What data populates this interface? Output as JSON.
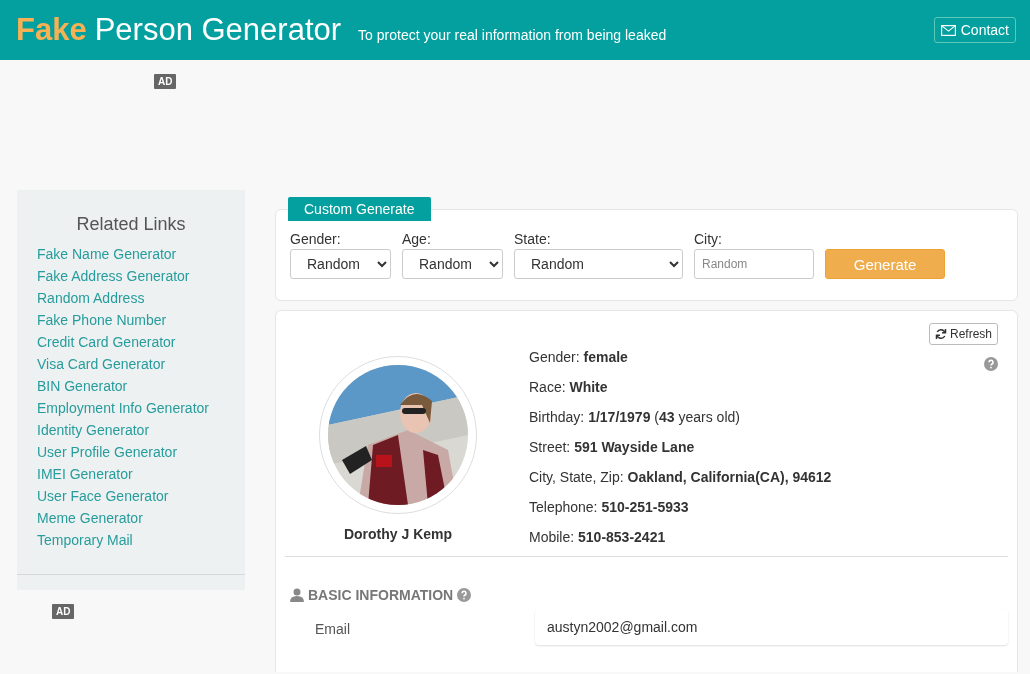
{
  "header": {
    "brand_accent": "Fake",
    "brand_rest": "Person Generator",
    "tagline": "To protect your real information from being leaked",
    "contact": "Contact"
  },
  "ads": [
    "AD",
    "AD"
  ],
  "sidebar": {
    "title": "Related Links",
    "links": [
      "Fake Name Generator",
      "Fake Address Generator",
      "Random Address",
      "Fake Phone Number",
      "Credit Card Generator",
      "Visa Card Generator",
      "BIN Generator",
      "Employment Info Generator",
      "Identity Generator",
      "User Profile Generator",
      "IMEI Generator",
      "User Face Generator",
      "Meme Generator",
      "Temporary Mail"
    ]
  },
  "custom_generate": {
    "tab": "Custom Generate",
    "fields": [
      {
        "kind": "select",
        "label": "Gender:",
        "value": "Random"
      },
      {
        "kind": "select",
        "label": "Age:",
        "value": "Random"
      },
      {
        "kind": "select",
        "label": "State:",
        "value": "Random"
      },
      {
        "kind": "input",
        "label": "City:",
        "placeholder": "Random"
      }
    ],
    "button": "Generate"
  },
  "profile": {
    "refresh": "Refresh",
    "name": "Dorothy J Kemp",
    "facts": [
      "Gender: **female**",
      "Race: **White**",
      "Birthday: **1/17/1979** (**43** years old)",
      "Street: **591 Wayside Lane**",
      "City, State, Zip: **Oakland, California(CA), 94612**",
      "Telephone: **510-251-5933**",
      "Mobile: **510-853-2421**"
    ]
  },
  "basic_information": {
    "title": "BASIC INFORMATION",
    "rows": [
      {
        "label": "Email",
        "value": "austyn2002@gmail.com"
      }
    ]
  }
}
